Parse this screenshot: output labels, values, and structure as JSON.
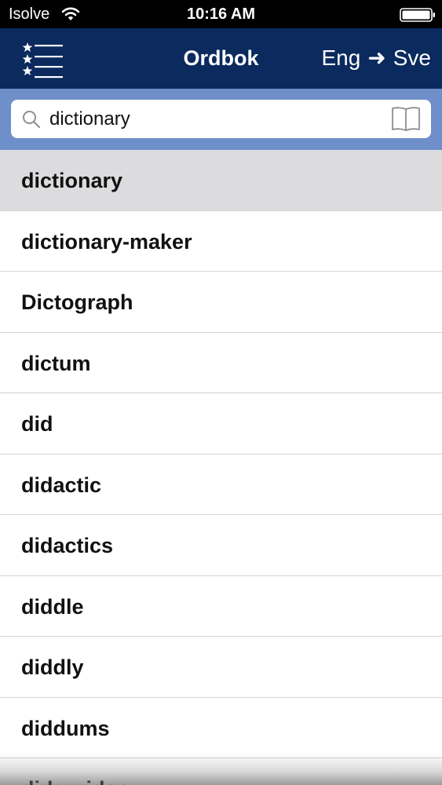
{
  "status_bar": {
    "carrier": "Isolve",
    "time": "10:16 AM",
    "icons": [
      "wifi-icon",
      "battery-icon"
    ]
  },
  "nav": {
    "menu_icon": "star-list-menu-icon",
    "title": "Ordbok",
    "lang_from": "Eng",
    "lang_arrow": "➜",
    "lang_to": "Sve"
  },
  "search": {
    "value": "dictionary",
    "placeholder": "",
    "icons": [
      "search-icon",
      "book-icon"
    ]
  },
  "results": [
    "dictionary",
    "dictionary-maker",
    "Dictograph",
    "dictum",
    "did",
    "didactic",
    "didactics",
    "diddle",
    "diddly",
    "diddums",
    "didgeridoo"
  ],
  "selected_index": 0,
  "colors": {
    "status_bar": "#000000",
    "nav_bar": "#0b2a5e",
    "search_area": "#6e8fca",
    "selected_row": "#dcdcdf",
    "divider": "#d4d4d8"
  }
}
